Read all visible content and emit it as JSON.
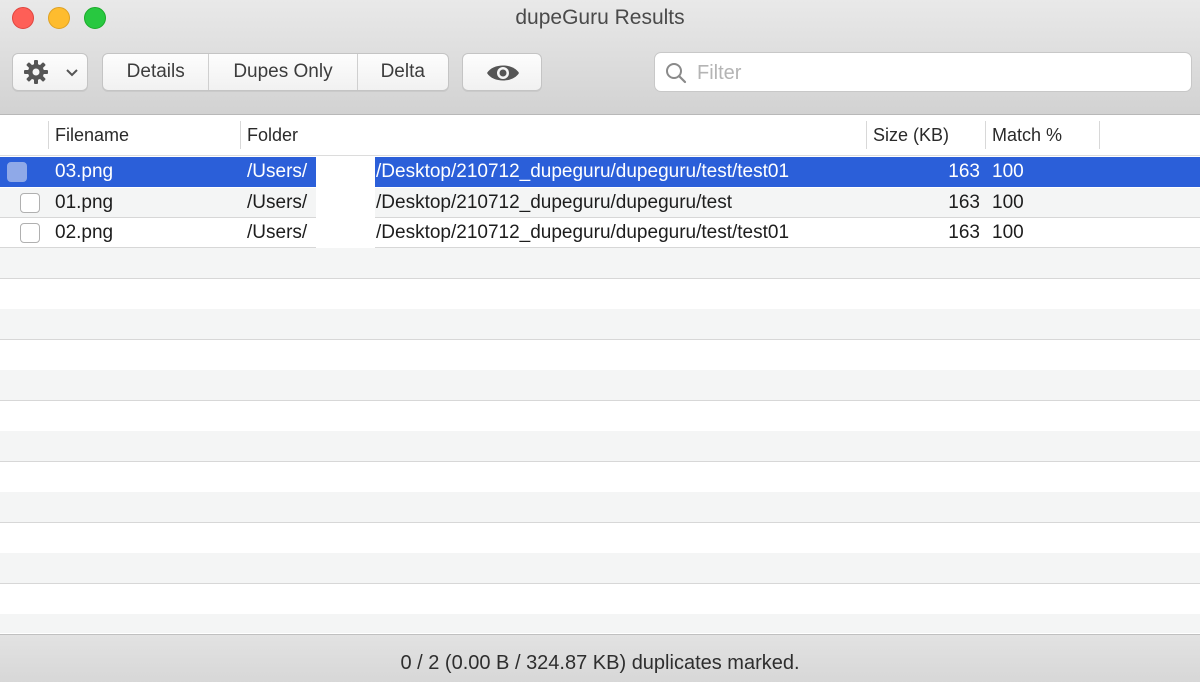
{
  "window": {
    "title": "dupeGuru Results"
  },
  "toolbar": {
    "action_menu_icon": "gear-icon",
    "action_menu_chevron": "chevron-down-icon",
    "view_segments": [
      "Details",
      "Dupes Only",
      "Delta"
    ],
    "preview_icon": "eye-icon",
    "filter_placeholder": "Filter",
    "filter_value": ""
  },
  "table": {
    "columns": [
      "Filename",
      "Folder",
      "Size (KB)",
      "Match %"
    ],
    "rows": [
      {
        "selected": true,
        "marked": false,
        "filename": "03.png",
        "folder_prefix": "/Users/",
        "folder_suffix": "/Desktop/210712_dupeguru/dupeguru/test/test01",
        "size": "163",
        "match": "100"
      },
      {
        "selected": false,
        "marked": false,
        "filename": "01.png",
        "folder_prefix": "/Users/",
        "folder_suffix": "/Desktop/210712_dupeguru/dupeguru/test",
        "size": "163",
        "match": "100"
      },
      {
        "selected": false,
        "marked": false,
        "filename": "02.png",
        "folder_prefix": "/Users/",
        "folder_suffix": "/Desktop/210712_dupeguru/dupeguru/test/test01",
        "size": "163",
        "match": "100"
      }
    ]
  },
  "status": {
    "text": "0 / 2 (0.00 B / 324.87 KB) duplicates marked."
  },
  "colors": {
    "selection": "#2b5fd9",
    "close": "#fe5f57",
    "minimize": "#febc2e",
    "maximize": "#28c840"
  }
}
